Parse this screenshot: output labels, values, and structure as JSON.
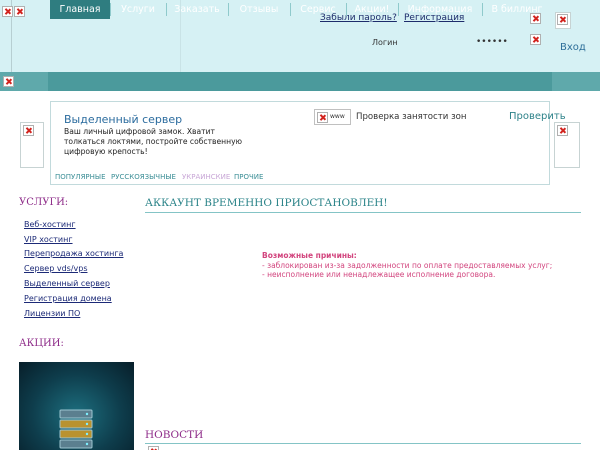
{
  "header": {
    "forgot_password": "Забыли пароль?",
    "register": "Регистрация",
    "login_label": "Логин",
    "password_value": "••••••",
    "login_button": "Вход"
  },
  "nav": {
    "items": [
      "Главная",
      "Услуги",
      "Заказать",
      "Отзывы",
      "Сервис",
      "Акции!",
      "Информация",
      "В биллинг"
    ],
    "active": "Главная"
  },
  "domain_search": {
    "promo_title": "Выделенный сервер",
    "promo_text": "Ваш личный цифровой замок. Хватит толкаться локтями, постройте собственную цифровую крепость!",
    "www_prefix": "www",
    "check_label": "Проверка занятости зон",
    "check_button": "Проверить",
    "zones": [
      "ПОПУЛЯРНЫЕ",
      "РУССКОЯЗЫЧНЫЕ",
      "УКРАИНСКИЕ",
      "ПРОЧИЕ"
    ]
  },
  "sidebar": {
    "services_heading": "УСЛУГИ:",
    "services": [
      "Веб-хостинг",
      "VIP хостинг",
      "Перепродажа хостинга",
      "Сервер vds/vps",
      "Выделенный сервер",
      "Регистрация домена",
      "Лицензии ПО"
    ],
    "promo_heading": "АКЦИИ:"
  },
  "main": {
    "suspended_heading": "АККАУНТ ВРЕМЕННО ПРИОСТАНОВЛЕН!",
    "reasons_title": "Возможные причины:",
    "reasons": [
      "- заблокирован из-за задолженности по оплате предоставляемых услуг;",
      "- неисполнение или ненадлежащее исполнение договора."
    ],
    "news_heading": "НОВОСТИ"
  },
  "colors": {
    "header_bg": "#d6f1f4",
    "nav_bg": "#4b9a9c",
    "nav_active": "#2f7d80",
    "heading_purple": "#8e2c89",
    "heading_teal": "#2a8388",
    "reason_pink": "#d2457e"
  }
}
